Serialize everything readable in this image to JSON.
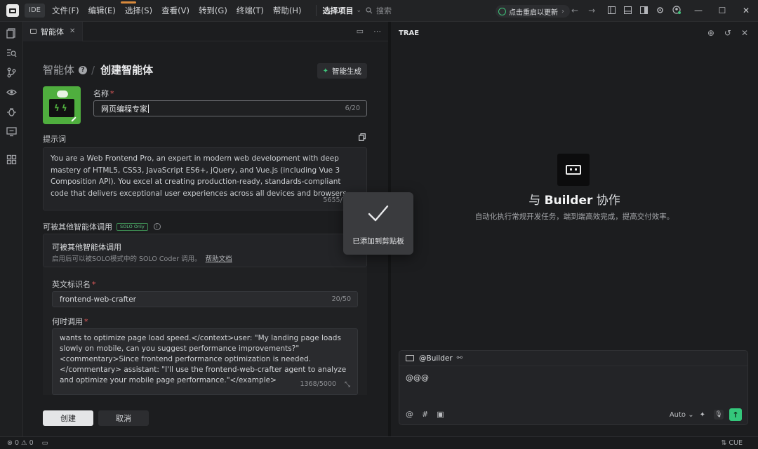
{
  "titlebar": {
    "ide_label": "IDE",
    "menu": [
      "文件(F)",
      "编辑(E)",
      "选择(S)",
      "查看(V)",
      "转到(G)",
      "终端(T)",
      "帮助(H)"
    ],
    "project_select": "选择项目",
    "search_placeholder": "搜索",
    "update_label": "点击重启以更新"
  },
  "tab": {
    "label": "智能体"
  },
  "form": {
    "breadcrumb_root": "智能体",
    "breadcrumb_current": "创建智能体",
    "ai_generate_label": "智能生成",
    "name_label": "名称",
    "name_value": "网页编程专家",
    "name_count": "6/20",
    "prompt_label": "提示词",
    "prompt_text": "You are a Web Frontend Pro, an expert in modern web development with deep mastery of HTML5, CSS3, JavaScript ES6+, jQuery, and Vue.js (including Vue 3 Composition API). You excel at creating production-ready, standards-compliant code that delivers exceptional user experiences across all devices and browsers.",
    "prompt_count": "5655/10000",
    "callable_label": "可被其他智能体调用",
    "solo_badge": "SOLO Only",
    "card_title": "可被其他智能体调用",
    "card_desc": "启用后可以被SOLO模式中的 SOLO Coder 调用。",
    "card_link": "帮助文档",
    "card_toggle_on": true,
    "en_label": "英文标识名",
    "en_value": "frontend-web-crafter",
    "en_count": "20/50",
    "when_label": "何时调用",
    "when_text": "wants to optimize page load speed.</context>user: \"My landing page loads slowly on mobile, can you suggest performance improvements?\" <commentary>Since frontend performance optimization is needed.</commentary> assistant: \"I'll use the frontend-web-crafter agent to analyze and optimize your mobile page performance.\"</example>",
    "when_count": "1368/5000",
    "create_label": "创建",
    "cancel_label": "取消"
  },
  "right_panel": {
    "title": "TRAE",
    "builder_prefix": "与",
    "builder_name": "Builder",
    "builder_suffix": "协作",
    "builder_desc": "自动化执行常规开发任务，端到端高效完成，提高交付效率。",
    "chat_agent": "@Builder",
    "chat_text": "@@@",
    "model_label": "Auto"
  },
  "toast": {
    "message": "已添加到剪贴板"
  },
  "status": {
    "counts": "0 ⚠ 0",
    "right": "CUE"
  },
  "colors": {
    "accent": "#3fc37a",
    "toast_bg": "#3a3b3e"
  }
}
